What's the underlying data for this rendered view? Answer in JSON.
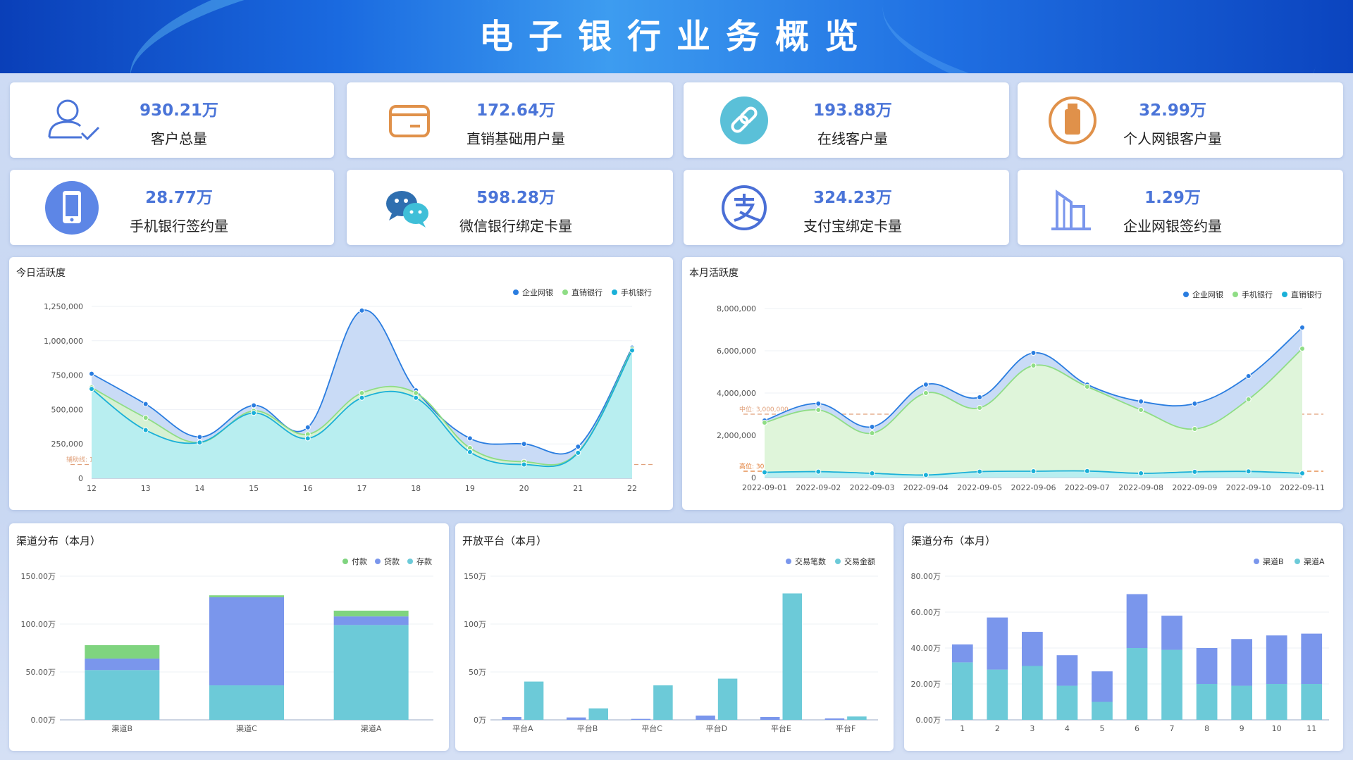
{
  "header": {
    "title": "电子银行业务概览"
  },
  "kpis": [
    {
      "value": "930.21万",
      "label": "客户总量",
      "icon": "user-check-icon"
    },
    {
      "value": "172.64万",
      "label": "直销基础用户量",
      "icon": "card-icon"
    },
    {
      "value": "193.88万",
      "label": "在线客户量",
      "icon": "link-icon"
    },
    {
      "value": "32.99万",
      "label": "个人网银客户量",
      "icon": "usb-key-icon"
    },
    {
      "value": "28.77万",
      "label": "手机银行签约量",
      "icon": "mobile-icon"
    },
    {
      "value": "598.28万",
      "label": "微信银行绑定卡量",
      "icon": "wechat-icon"
    },
    {
      "value": "324.23万",
      "label": "支付宝绑定卡量",
      "icon": "alipay-icon"
    },
    {
      "value": "1.29万",
      "label": "企业网银签约量",
      "icon": "building-icon"
    }
  ],
  "colors": {
    "blue": "#2a7de0",
    "green": "#8fdd85",
    "cyan": "#1ab0d8",
    "bar_purple": "#7a96ec",
    "bar_cyan": "#6ccad8",
    "bar_green": "#7fd47f",
    "ref_line": "#e0a07a",
    "ref_line_dark": "#e07a30"
  },
  "chart_data": [
    {
      "id": "today",
      "type": "area",
      "title": "今日活跃度",
      "x": [
        "12",
        "13",
        "14",
        "15",
        "16",
        "17",
        "18",
        "19",
        "20",
        "21",
        "22"
      ],
      "ylim": [
        0,
        1250000
      ],
      "yticks": [
        "0",
        "250,000",
        "500,000",
        "750,000",
        "1,000,000",
        "1,250,000"
      ],
      "series": [
        {
          "name": "企业网银",
          "values": [
            760000,
            540000,
            300000,
            530000,
            370000,
            1220000,
            640000,
            290000,
            250000,
            230000,
            950000
          ]
        },
        {
          "name": "直销银行",
          "values": [
            660000,
            440000,
            260000,
            490000,
            320000,
            620000,
            620000,
            220000,
            120000,
            190000,
            940000
          ]
        },
        {
          "name": "手机银行",
          "values": [
            650000,
            350000,
            260000,
            475000,
            290000,
            585000,
            585000,
            190000,
            100000,
            185000,
            930000
          ]
        }
      ],
      "legend": "top-right",
      "annotations": [
        {
          "text": "辅助线: 100,000",
          "y": 100000
        }
      ]
    },
    {
      "id": "month",
      "type": "area",
      "title": "本月活跃度",
      "x": [
        "2022-09-01",
        "2022-09-02",
        "2022-09-03",
        "2022-09-04",
        "2022-09-05",
        "2022-09-06",
        "2022-09-07",
        "2022-09-08",
        "2022-09-09",
        "2022-09-10",
        "2022-09-11"
      ],
      "ylim": [
        0,
        8000000
      ],
      "yticks": [
        "0",
        "2,000,000",
        "4,000,000",
        "6,000,000",
        "8,000,000"
      ],
      "series": [
        {
          "name": "企业网银",
          "values": [
            2700000,
            3500000,
            2400000,
            4400000,
            3800000,
            5900000,
            4400000,
            3600000,
            3500000,
            4800000,
            7100000
          ]
        },
        {
          "name": "手机银行",
          "values": [
            2600000,
            3200000,
            2100000,
            4000000,
            3300000,
            5300000,
            4300000,
            3200000,
            2300000,
            3700000,
            6100000
          ]
        },
        {
          "name": "直销银行",
          "values": [
            250000,
            280000,
            200000,
            120000,
            280000,
            300000,
            310000,
            200000,
            270000,
            290000,
            200000
          ]
        }
      ],
      "legend": "top-right",
      "annotations": [
        {
          "text": "中位: 3,000,000",
          "y": 3000000
        },
        {
          "text": "高位: 300,000",
          "y": 300000
        }
      ]
    },
    {
      "id": "channel1",
      "type": "bar",
      "title": "渠道分布（本月）",
      "categories": [
        "渠道B",
        "渠道C",
        "渠道A"
      ],
      "ylim": [
        0,
        1500000
      ],
      "yticks": [
        "0.00万",
        "50.00万",
        "100.00万",
        "150.00万"
      ],
      "stacked": true,
      "series": [
        {
          "name": "付款",
          "values": [
            140000,
            20000,
            60000
          ]
        },
        {
          "name": "贷款",
          "values": [
            120000,
            920000,
            90000
          ]
        },
        {
          "name": "存款",
          "values": [
            520000,
            360000,
            990000
          ]
        }
      ],
      "legend": "top-right"
    },
    {
      "id": "platform",
      "type": "bar",
      "title": "开放平台（本月）",
      "categories": [
        "平台A",
        "平台B",
        "平台C",
        "平台D",
        "平台E",
        "平台F"
      ],
      "ylim": [
        0,
        1500000
      ],
      "yticks": [
        "0万",
        "50万",
        "100万",
        "150万"
      ],
      "series": [
        {
          "name": "交易笔数",
          "values": [
            30000,
            25000,
            10000,
            45000,
            30000,
            15000
          ]
        },
        {
          "name": "交易金额",
          "values": [
            400000,
            120000,
            360000,
            430000,
            1320000,
            35000
          ]
        }
      ],
      "legend": "top-right"
    },
    {
      "id": "channel2",
      "type": "bar",
      "title": "渠道分布（本月）",
      "categories": [
        "1",
        "2",
        "3",
        "4",
        "5",
        "6",
        "7",
        "8",
        "9",
        "10",
        "11"
      ],
      "ylim": [
        0,
        800000
      ],
      "yticks": [
        "0.00万",
        "20.00万",
        "40.00万",
        "60.00万",
        "80.00万"
      ],
      "stacked": true,
      "series": [
        {
          "name": "渠道B",
          "values": [
            100000,
            290000,
            190000,
            170000,
            170000,
            300000,
            190000,
            200000,
            260000,
            270000,
            280000
          ]
        },
        {
          "name": "渠道A",
          "values": [
            320000,
            280000,
            300000,
            190000,
            100000,
            400000,
            390000,
            200000,
            190000,
            200000,
            200000
          ]
        }
      ],
      "legend": "top-right"
    }
  ]
}
